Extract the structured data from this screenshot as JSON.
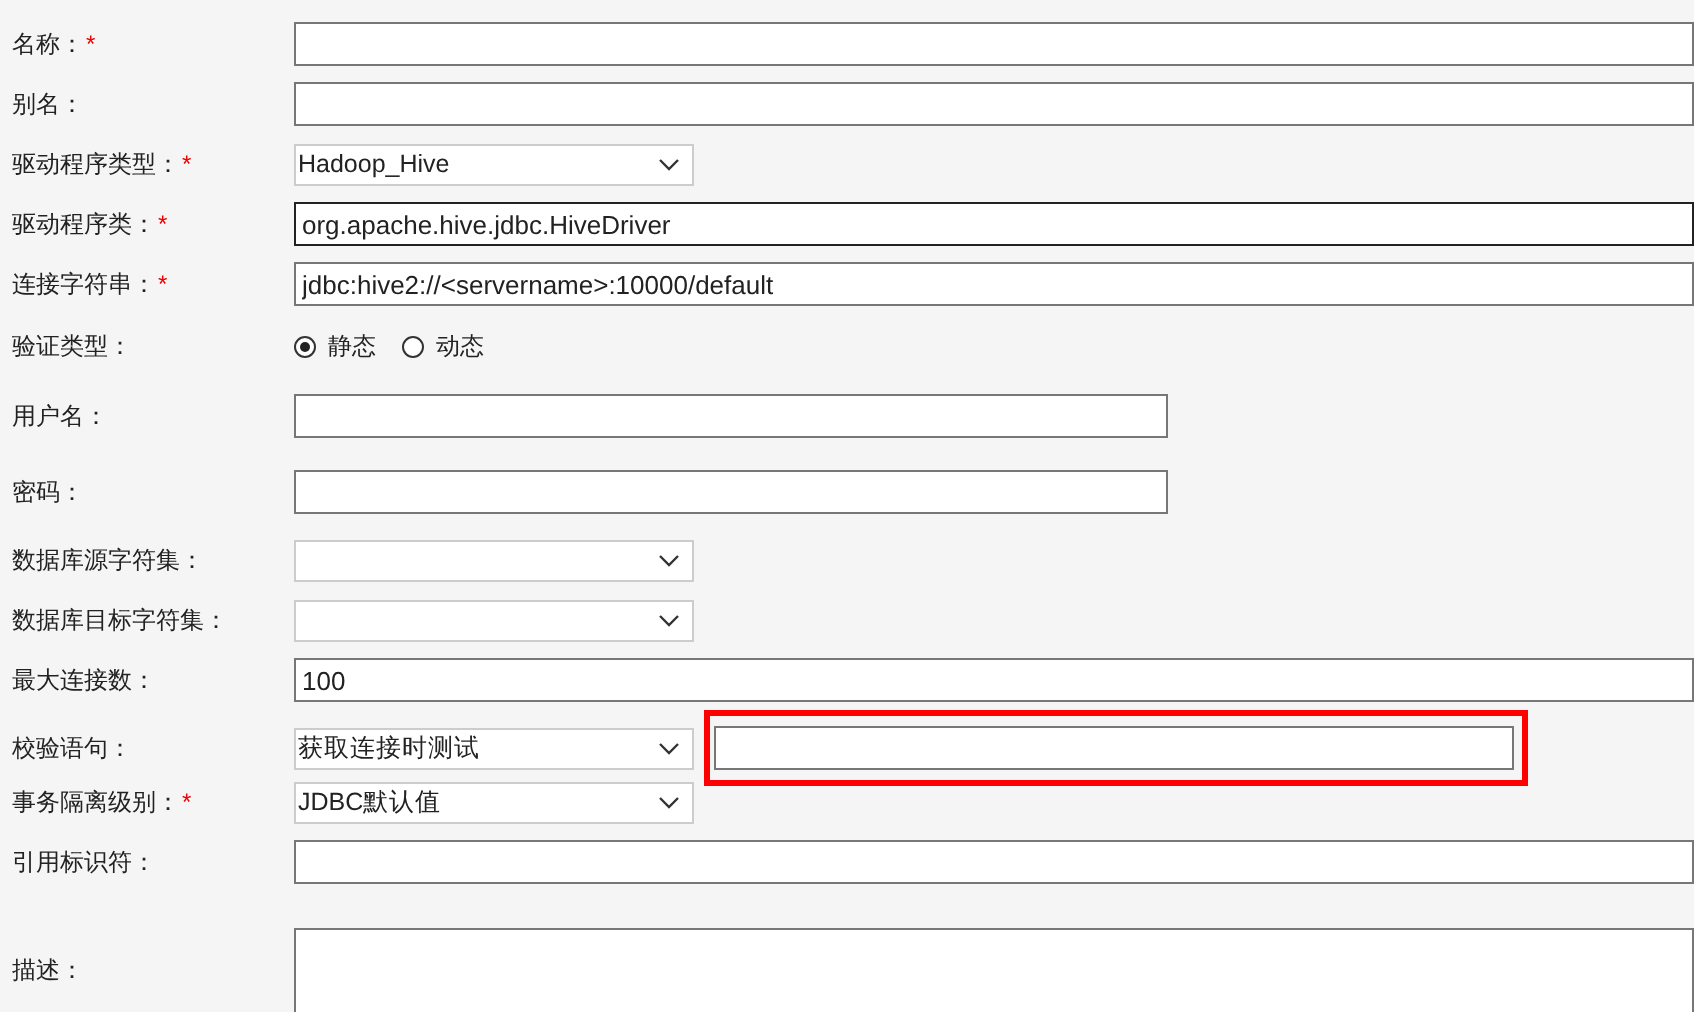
{
  "form": {
    "fields": [
      {
        "label": "名称：",
        "required_mark": "*",
        "kind": "text"
      },
      {
        "label": "别名：",
        "kind": "text"
      },
      {
        "label": "驱动程序类型：",
        "required_mark": "*",
        "kind": "select",
        "value": "Hadoop_Hive"
      },
      {
        "label": "驱动程序类：",
        "required_mark": "*",
        "kind": "text",
        "value": "org.apache.hive.jdbc.HiveDriver",
        "focused": true
      },
      {
        "label": "连接字符串：",
        "required_mark": "*",
        "kind": "text",
        "value": "jdbc:hive2://<servername>:10000/default"
      },
      {
        "label": "验证类型：",
        "kind": "radio",
        "options": [
          {
            "label": "静态",
            "selected": true
          },
          {
            "label": "动态",
            "selected": false
          }
        ]
      },
      {
        "label": "用户名：",
        "kind": "short"
      },
      {
        "label": "密码：",
        "kind": "short"
      },
      {
        "label": "数据库源字符集：",
        "kind": "select"
      },
      {
        "label": "数据库目标字符集：",
        "kind": "select"
      },
      {
        "label": "最大连接数：",
        "kind": "text",
        "value": "100"
      },
      {
        "label": "校验语句：",
        "kind": "select_input",
        "value": "获取连接时测试",
        "extra": {
          "highlighted": true
        }
      },
      {
        "label": "事务隔离级别：",
        "required_mark": "*",
        "kind": "select",
        "value": "JDBC默认值"
      },
      {
        "label": "引用标识符：",
        "kind": "text"
      },
      {
        "label": "描述：",
        "kind": "textarea"
      }
    ]
  }
}
